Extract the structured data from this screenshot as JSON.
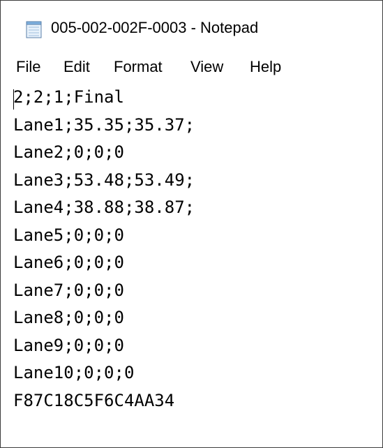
{
  "window": {
    "title": "005-002-002F-0003 - Notepad",
    "app_icon": "notepad-icon"
  },
  "menu": {
    "file": "File",
    "edit": "Edit",
    "format": "Format",
    "view": "View",
    "help": "Help"
  },
  "document": {
    "lines": [
      "2;2;1;Final",
      "Lane1;35.35;35.37;",
      "Lane2;0;0;0",
      "Lane3;53.48;53.49;",
      "Lane4;38.88;38.87;",
      "Lane5;0;0;0",
      "Lane6;0;0;0",
      "Lane7;0;0;0",
      "Lane8;0;0;0",
      "Lane9;0;0;0",
      "Lane10;0;0;0",
      "F87C18C5F6C4AA34"
    ]
  }
}
